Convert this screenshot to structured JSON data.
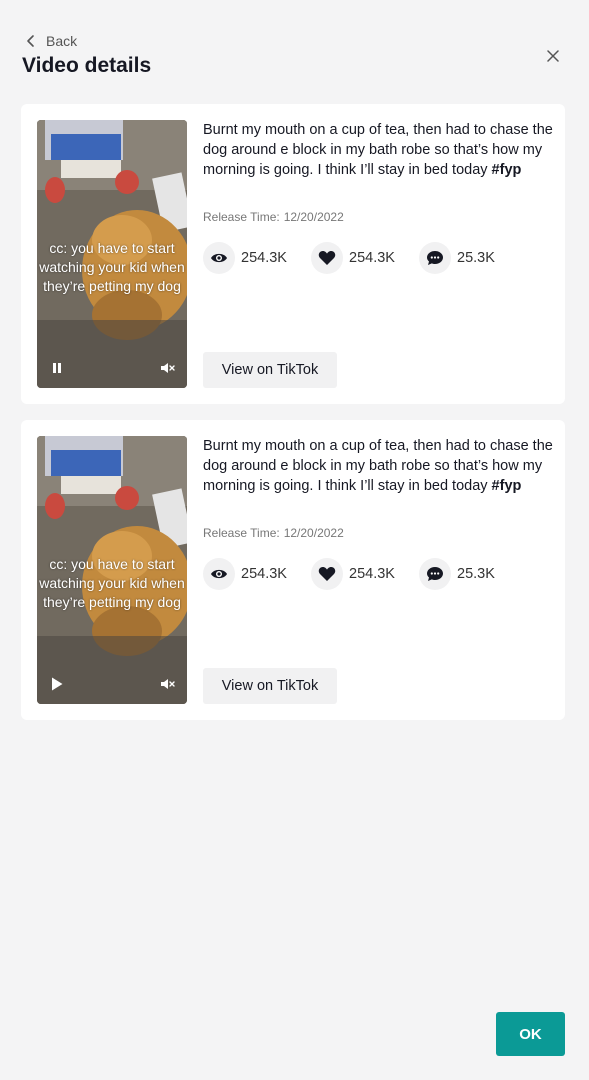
{
  "header": {
    "back_label": "Back",
    "title": "Video details"
  },
  "videos": [
    {
      "description": "Burnt my mouth on a cup of tea, then had to chase the dog around e block in my bath robe so that’s how my morning is going. I think I’ll stay in bed today ",
      "hashtag": "#fyp",
      "overlay_lines": [
        "cc: you have to start",
        "watching your kid when",
        "they’re petting my dog"
      ],
      "release_label": "Release Time:",
      "release_date": "12/20/2022",
      "views": "254.3K",
      "likes": "254.3K",
      "comments": "25.3K",
      "button_label": "View on TikTok",
      "playback_icon": "pause-icon"
    },
    {
      "description": "Burnt my mouth on a cup of tea, then had to chase the dog around e block in my bath robe so that’s how my morning is going. I think I’ll stay in bed today ",
      "hashtag": "#fyp",
      "overlay_lines": [
        "cc: you have to start",
        "watching your kid when",
        "they’re petting my dog"
      ],
      "release_label": "Release Time:",
      "release_date": "12/20/2022",
      "views": "254.3K",
      "likes": "254.3K",
      "comments": "25.3K",
      "button_label": "View on TikTok",
      "playback_icon": "play-icon"
    }
  ],
  "footer": {
    "ok_label": "OK"
  },
  "colors": {
    "accent": "#0b9a96",
    "background": "#f4f4f5",
    "card": "#ffffff"
  }
}
